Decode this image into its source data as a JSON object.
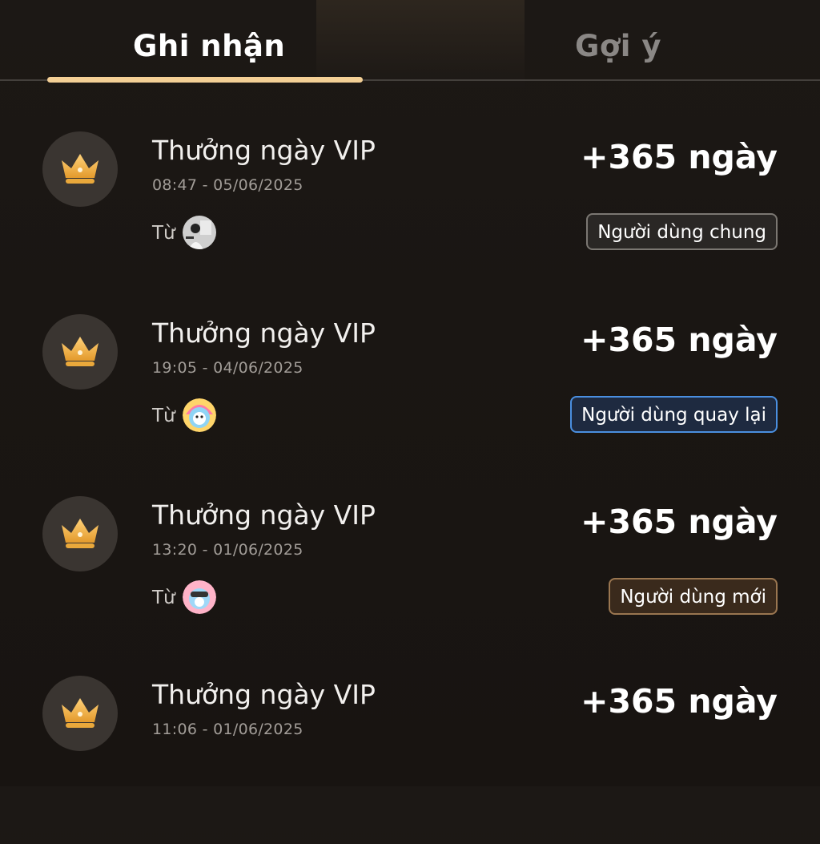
{
  "tabs": [
    {
      "label": "Ghi nhận",
      "active": true
    },
    {
      "label": "Gợi ý",
      "active": false
    }
  ],
  "colors": {
    "accent": "#f3cf95",
    "crown": "#f0b545",
    "background": "#1a1613"
  },
  "records": [
    {
      "icon": "crown-icon",
      "title": "Thưởng ngày VIP",
      "time": "08:47 - 05/06/2025",
      "amount": "+365 ngày",
      "from_label": "Từ",
      "avatar": "photo-avatar",
      "badge": "Người dùng chung",
      "badge_type": "general"
    },
    {
      "icon": "crown-icon",
      "title": "Thưởng ngày VIP",
      "time": "19:05 - 04/06/2025",
      "amount": "+365 ngày",
      "from_label": "Từ",
      "avatar": "cartoon-avatar",
      "badge": "Người dùng quay lại",
      "badge_type": "returning"
    },
    {
      "icon": "crown-icon",
      "title": "Thưởng ngày VIP",
      "time": "13:20 - 01/06/2025",
      "amount": "+365 ngày",
      "from_label": "Từ",
      "avatar": "cartoon-avatar",
      "badge": "Người dùng mới",
      "badge_type": "new"
    },
    {
      "icon": "crown-icon",
      "title": "Thưởng ngày VIP",
      "time": "11:06 - 01/06/2025",
      "amount": "+365 ngày"
    }
  ]
}
